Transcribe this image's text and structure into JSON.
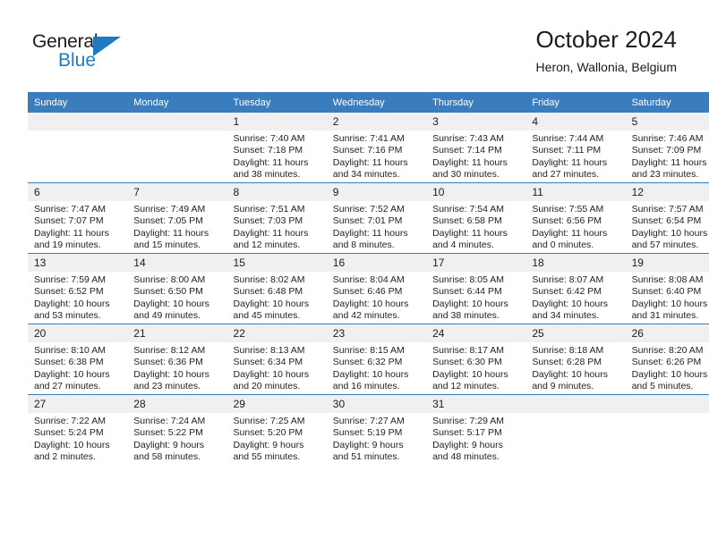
{
  "brand": {
    "name_part1": "General",
    "name_part2": "Blue",
    "accent_color": "#1f7bc1"
  },
  "header": {
    "title": "October 2024",
    "subtitle": "Heron, Wallonia, Belgium"
  },
  "colors": {
    "header_row": "#3a7dbf",
    "daynum_band": "#f0f0f0",
    "text": "#1b1b1b"
  },
  "weekday_headers": [
    "Sunday",
    "Monday",
    "Tuesday",
    "Wednesday",
    "Thursday",
    "Friday",
    "Saturday"
  ],
  "weeks": [
    [
      {
        "day": "",
        "sunrise": "",
        "sunset": "",
        "daylight_line1": "",
        "daylight_line2": ""
      },
      {
        "day": "",
        "sunrise": "",
        "sunset": "",
        "daylight_line1": "",
        "daylight_line2": ""
      },
      {
        "day": "1",
        "sunrise": "Sunrise: 7:40 AM",
        "sunset": "Sunset: 7:18 PM",
        "daylight_line1": "Daylight: 11 hours",
        "daylight_line2": "and 38 minutes."
      },
      {
        "day": "2",
        "sunrise": "Sunrise: 7:41 AM",
        "sunset": "Sunset: 7:16 PM",
        "daylight_line1": "Daylight: 11 hours",
        "daylight_line2": "and 34 minutes."
      },
      {
        "day": "3",
        "sunrise": "Sunrise: 7:43 AM",
        "sunset": "Sunset: 7:14 PM",
        "daylight_line1": "Daylight: 11 hours",
        "daylight_line2": "and 30 minutes."
      },
      {
        "day": "4",
        "sunrise": "Sunrise: 7:44 AM",
        "sunset": "Sunset: 7:11 PM",
        "daylight_line1": "Daylight: 11 hours",
        "daylight_line2": "and 27 minutes."
      },
      {
        "day": "5",
        "sunrise": "Sunrise: 7:46 AM",
        "sunset": "Sunset: 7:09 PM",
        "daylight_line1": "Daylight: 11 hours",
        "daylight_line2": "and 23 minutes."
      }
    ],
    [
      {
        "day": "6",
        "sunrise": "Sunrise: 7:47 AM",
        "sunset": "Sunset: 7:07 PM",
        "daylight_line1": "Daylight: 11 hours",
        "daylight_line2": "and 19 minutes."
      },
      {
        "day": "7",
        "sunrise": "Sunrise: 7:49 AM",
        "sunset": "Sunset: 7:05 PM",
        "daylight_line1": "Daylight: 11 hours",
        "daylight_line2": "and 15 minutes."
      },
      {
        "day": "8",
        "sunrise": "Sunrise: 7:51 AM",
        "sunset": "Sunset: 7:03 PM",
        "daylight_line1": "Daylight: 11 hours",
        "daylight_line2": "and 12 minutes."
      },
      {
        "day": "9",
        "sunrise": "Sunrise: 7:52 AM",
        "sunset": "Sunset: 7:01 PM",
        "daylight_line1": "Daylight: 11 hours",
        "daylight_line2": "and 8 minutes."
      },
      {
        "day": "10",
        "sunrise": "Sunrise: 7:54 AM",
        "sunset": "Sunset: 6:58 PM",
        "daylight_line1": "Daylight: 11 hours",
        "daylight_line2": "and 4 minutes."
      },
      {
        "day": "11",
        "sunrise": "Sunrise: 7:55 AM",
        "sunset": "Sunset: 6:56 PM",
        "daylight_line1": "Daylight: 11 hours",
        "daylight_line2": "and 0 minutes."
      },
      {
        "day": "12",
        "sunrise": "Sunrise: 7:57 AM",
        "sunset": "Sunset: 6:54 PM",
        "daylight_line1": "Daylight: 10 hours",
        "daylight_line2": "and 57 minutes."
      }
    ],
    [
      {
        "day": "13",
        "sunrise": "Sunrise: 7:59 AM",
        "sunset": "Sunset: 6:52 PM",
        "daylight_line1": "Daylight: 10 hours",
        "daylight_line2": "and 53 minutes."
      },
      {
        "day": "14",
        "sunrise": "Sunrise: 8:00 AM",
        "sunset": "Sunset: 6:50 PM",
        "daylight_line1": "Daylight: 10 hours",
        "daylight_line2": "and 49 minutes."
      },
      {
        "day": "15",
        "sunrise": "Sunrise: 8:02 AM",
        "sunset": "Sunset: 6:48 PM",
        "daylight_line1": "Daylight: 10 hours",
        "daylight_line2": "and 45 minutes."
      },
      {
        "day": "16",
        "sunrise": "Sunrise: 8:04 AM",
        "sunset": "Sunset: 6:46 PM",
        "daylight_line1": "Daylight: 10 hours",
        "daylight_line2": "and 42 minutes."
      },
      {
        "day": "17",
        "sunrise": "Sunrise: 8:05 AM",
        "sunset": "Sunset: 6:44 PM",
        "daylight_line1": "Daylight: 10 hours",
        "daylight_line2": "and 38 minutes."
      },
      {
        "day": "18",
        "sunrise": "Sunrise: 8:07 AM",
        "sunset": "Sunset: 6:42 PM",
        "daylight_line1": "Daylight: 10 hours",
        "daylight_line2": "and 34 minutes."
      },
      {
        "day": "19",
        "sunrise": "Sunrise: 8:08 AM",
        "sunset": "Sunset: 6:40 PM",
        "daylight_line1": "Daylight: 10 hours",
        "daylight_line2": "and 31 minutes."
      }
    ],
    [
      {
        "day": "20",
        "sunrise": "Sunrise: 8:10 AM",
        "sunset": "Sunset: 6:38 PM",
        "daylight_line1": "Daylight: 10 hours",
        "daylight_line2": "and 27 minutes."
      },
      {
        "day": "21",
        "sunrise": "Sunrise: 8:12 AM",
        "sunset": "Sunset: 6:36 PM",
        "daylight_line1": "Daylight: 10 hours",
        "daylight_line2": "and 23 minutes."
      },
      {
        "day": "22",
        "sunrise": "Sunrise: 8:13 AM",
        "sunset": "Sunset: 6:34 PM",
        "daylight_line1": "Daylight: 10 hours",
        "daylight_line2": "and 20 minutes."
      },
      {
        "day": "23",
        "sunrise": "Sunrise: 8:15 AM",
        "sunset": "Sunset: 6:32 PM",
        "daylight_line1": "Daylight: 10 hours",
        "daylight_line2": "and 16 minutes."
      },
      {
        "day": "24",
        "sunrise": "Sunrise: 8:17 AM",
        "sunset": "Sunset: 6:30 PM",
        "daylight_line1": "Daylight: 10 hours",
        "daylight_line2": "and 12 minutes."
      },
      {
        "day": "25",
        "sunrise": "Sunrise: 8:18 AM",
        "sunset": "Sunset: 6:28 PM",
        "daylight_line1": "Daylight: 10 hours",
        "daylight_line2": "and 9 minutes."
      },
      {
        "day": "26",
        "sunrise": "Sunrise: 8:20 AM",
        "sunset": "Sunset: 6:26 PM",
        "daylight_line1": "Daylight: 10 hours",
        "daylight_line2": "and 5 minutes."
      }
    ],
    [
      {
        "day": "27",
        "sunrise": "Sunrise: 7:22 AM",
        "sunset": "Sunset: 5:24 PM",
        "daylight_line1": "Daylight: 10 hours",
        "daylight_line2": "and 2 minutes."
      },
      {
        "day": "28",
        "sunrise": "Sunrise: 7:24 AM",
        "sunset": "Sunset: 5:22 PM",
        "daylight_line1": "Daylight: 9 hours",
        "daylight_line2": "and 58 minutes."
      },
      {
        "day": "29",
        "sunrise": "Sunrise: 7:25 AM",
        "sunset": "Sunset: 5:20 PM",
        "daylight_line1": "Daylight: 9 hours",
        "daylight_line2": "and 55 minutes."
      },
      {
        "day": "30",
        "sunrise": "Sunrise: 7:27 AM",
        "sunset": "Sunset: 5:19 PM",
        "daylight_line1": "Daylight: 9 hours",
        "daylight_line2": "and 51 minutes."
      },
      {
        "day": "31",
        "sunrise": "Sunrise: 7:29 AM",
        "sunset": "Sunset: 5:17 PM",
        "daylight_line1": "Daylight: 9 hours",
        "daylight_line2": "and 48 minutes."
      },
      {
        "day": "",
        "sunrise": "",
        "sunset": "",
        "daylight_line1": "",
        "daylight_line2": ""
      },
      {
        "day": "",
        "sunrise": "",
        "sunset": "",
        "daylight_line1": "",
        "daylight_line2": ""
      }
    ]
  ]
}
